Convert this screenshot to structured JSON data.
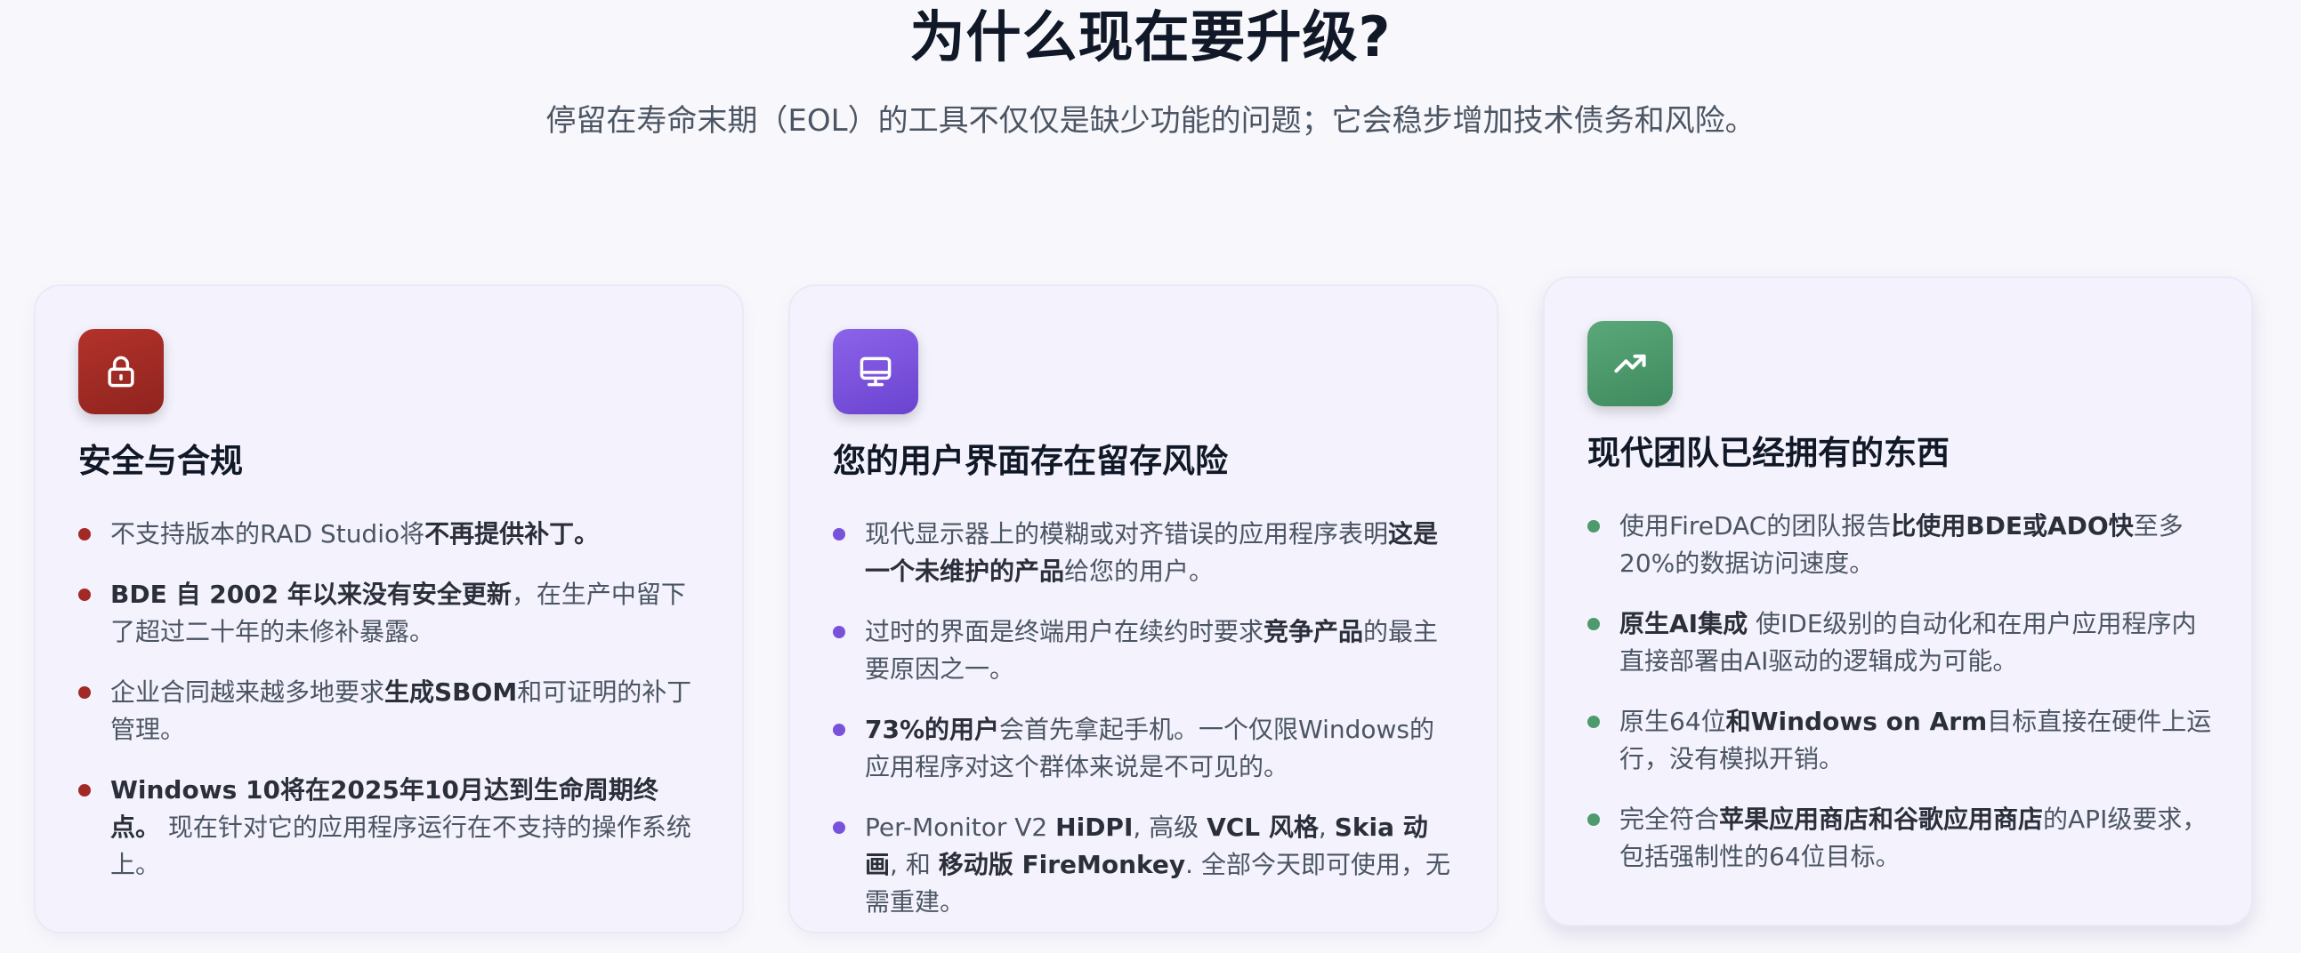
{
  "header": {
    "title": "为什么现在要升级?",
    "subtitle": "停留在寿命末期（EOL）的工具不仅仅是缺少功能的问题；它会稳步增加技术债务和风险。"
  },
  "colors": {
    "red": "#a32a24",
    "purple": "#7952dc",
    "green": "#4e9a6c"
  },
  "cards": [
    {
      "icon": "lock-icon",
      "accent": "#a32a24",
      "title": "安全与合规",
      "points": [
        [
          {
            "t": "不支持版本的RAD Studio将"
          },
          {
            "t": "不再提供补丁。",
            "b": true
          }
        ],
        [
          {
            "t": "BDE 自 2002 年以来没有安全更新",
            "b": true
          },
          {
            "t": "，在生产中留下了超过二十年的未修补暴露。"
          }
        ],
        [
          {
            "t": "企业合同越来越多地要求"
          },
          {
            "t": "生成SBOM",
            "b": true
          },
          {
            "t": "和可证明的补丁管理。"
          }
        ],
        [
          {
            "t": "Windows 10将在2025年10月达到生命周期终点。",
            "b": true
          },
          {
            "t": " 现在针对它的应用程序运行在不支持的操作系统上。"
          }
        ]
      ]
    },
    {
      "icon": "monitor-icon",
      "accent": "#7952dc",
      "title": "您的用户界面存在留存风险",
      "points": [
        [
          {
            "t": "现代显示器上的模糊或对齐错误的应用程序表明"
          },
          {
            "t": "这是一个未维护的产品",
            "b": true
          },
          {
            "t": "给您的用户。"
          }
        ],
        [
          {
            "t": "过时的界面是终端用户在续约时要求"
          },
          {
            "t": "竞争产品",
            "b": true
          },
          {
            "t": "的最主要原因之一。"
          }
        ],
        [
          {
            "t": "73%的用户",
            "b": true
          },
          {
            "t": "会首先拿起手机。一个仅限Windows的应用程序对这个群体来说是不可见的。"
          }
        ],
        [
          {
            "t": "Per-Monitor V2 "
          },
          {
            "t": "HiDPI",
            "b": true
          },
          {
            "t": ", 高级 "
          },
          {
            "t": "VCL 风格",
            "b": true
          },
          {
            "t": ", "
          },
          {
            "t": "Skia 动画",
            "b": true
          },
          {
            "t": ", 和 "
          },
          {
            "t": "移动版 FireMonkey",
            "b": true
          },
          {
            "t": ". 全部今天即可使用，无需重建。"
          }
        ]
      ]
    },
    {
      "icon": "trending-up-icon",
      "accent": "#4e9a6c",
      "title": "现代团队已经拥有的东西",
      "points": [
        [
          {
            "t": "使用FireDAC的团队报告"
          },
          {
            "t": "比使用BDE或ADO快",
            "b": true
          },
          {
            "t": "至多20%的数据访问速度。"
          }
        ],
        [
          {
            "t": "原生AI集成",
            "b": true
          },
          {
            "t": " 使IDE级别的自动化和在用户应用程序内直接部署由AI驱动的逻辑成为可能。"
          }
        ],
        [
          {
            "t": "原生64位"
          },
          {
            "t": "和Windows on Arm",
            "b": true
          },
          {
            "t": "目标直接在硬件上运行，没有模拟开销。"
          }
        ],
        [
          {
            "t": "完全符合"
          },
          {
            "t": "苹果应用商店和谷歌应用商店",
            "b": true
          },
          {
            "t": "的API级要求，包括强制性的64位目标。"
          }
        ]
      ]
    }
  ]
}
